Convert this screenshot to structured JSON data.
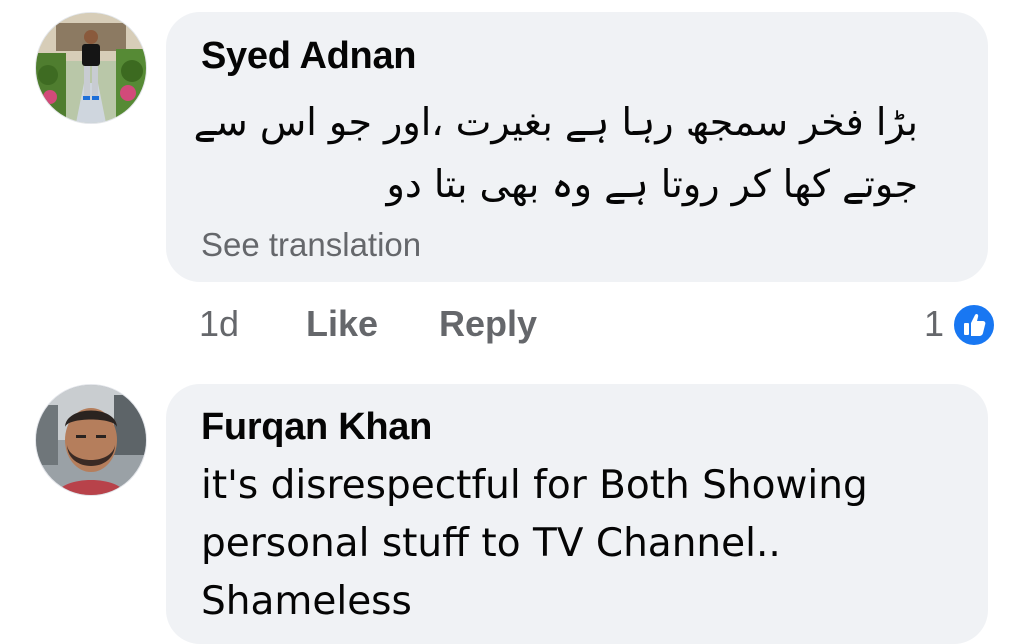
{
  "comments": [
    {
      "author": "Syed Adnan",
      "text_lines": [
        "بڑا فخر سمجھ رہا ہے بغیرت ،اور جو اس سے",
        "جوتے کھا کر روتا ہے وہ بھی بتا دو"
      ],
      "see_translation": "See translation",
      "time": "1d",
      "like_label": "Like",
      "reply_label": "Reply",
      "reaction_count": "1",
      "reaction_icon": "like-thumb-icon",
      "avatar_icon": "profile-photo-man-garden"
    },
    {
      "author": "Furqan Khan",
      "text_lines": [
        "it's disrespectful for Both Showing",
        "personal stuff to TV Channel..",
        "Shameless"
      ],
      "avatar_icon": "profile-photo-man-car"
    }
  ],
  "colors": {
    "bubble": "#f0f2f5",
    "meta_text": "#65676b",
    "text": "#050505",
    "like_blue": "#1877f2"
  }
}
